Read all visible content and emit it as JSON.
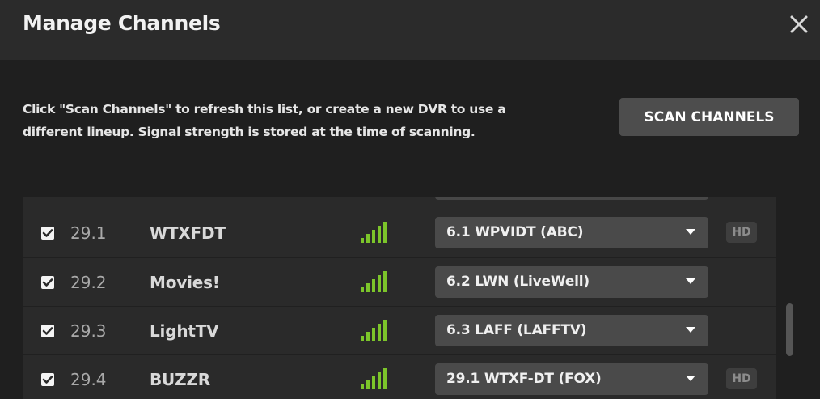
{
  "header": {
    "title": "Manage Channels",
    "close_icon": "close-icon"
  },
  "intro": {
    "description": "Click \"Scan Channels\" to refresh this list, or create a new DVR to use a different lineup. Signal strength is stored at the time of scanning.",
    "scan_button_label": "SCAN CHANNELS"
  },
  "channels": [
    {
      "checked": true,
      "number": "29.1",
      "name": "WTXFDT",
      "signal_bars": 5,
      "selected_guide": "6.1 WPVIDT (ABC)",
      "hd_badge": "HD"
    },
    {
      "checked": true,
      "number": "29.2",
      "name": "Movies!",
      "signal_bars": 5,
      "selected_guide": "6.2 LWN (LiveWell)",
      "hd_badge": ""
    },
    {
      "checked": true,
      "number": "29.3",
      "name": "LightTV",
      "signal_bars": 5,
      "selected_guide": "6.3 LAFF (LAFFTV)",
      "hd_badge": ""
    },
    {
      "checked": true,
      "number": "29.4",
      "name": "BUZZR",
      "signal_bars": 5,
      "selected_guide": "29.1 WTXF-DT (FOX)",
      "hd_badge": "HD"
    }
  ],
  "colors": {
    "signal_green": "#7cc52a",
    "background": "#1f1f1f",
    "header_bg": "#2b2b2b",
    "row_bg": "#2a2a2a",
    "select_bg": "#4a4a4a",
    "button_bg": "#4d4d4d"
  }
}
